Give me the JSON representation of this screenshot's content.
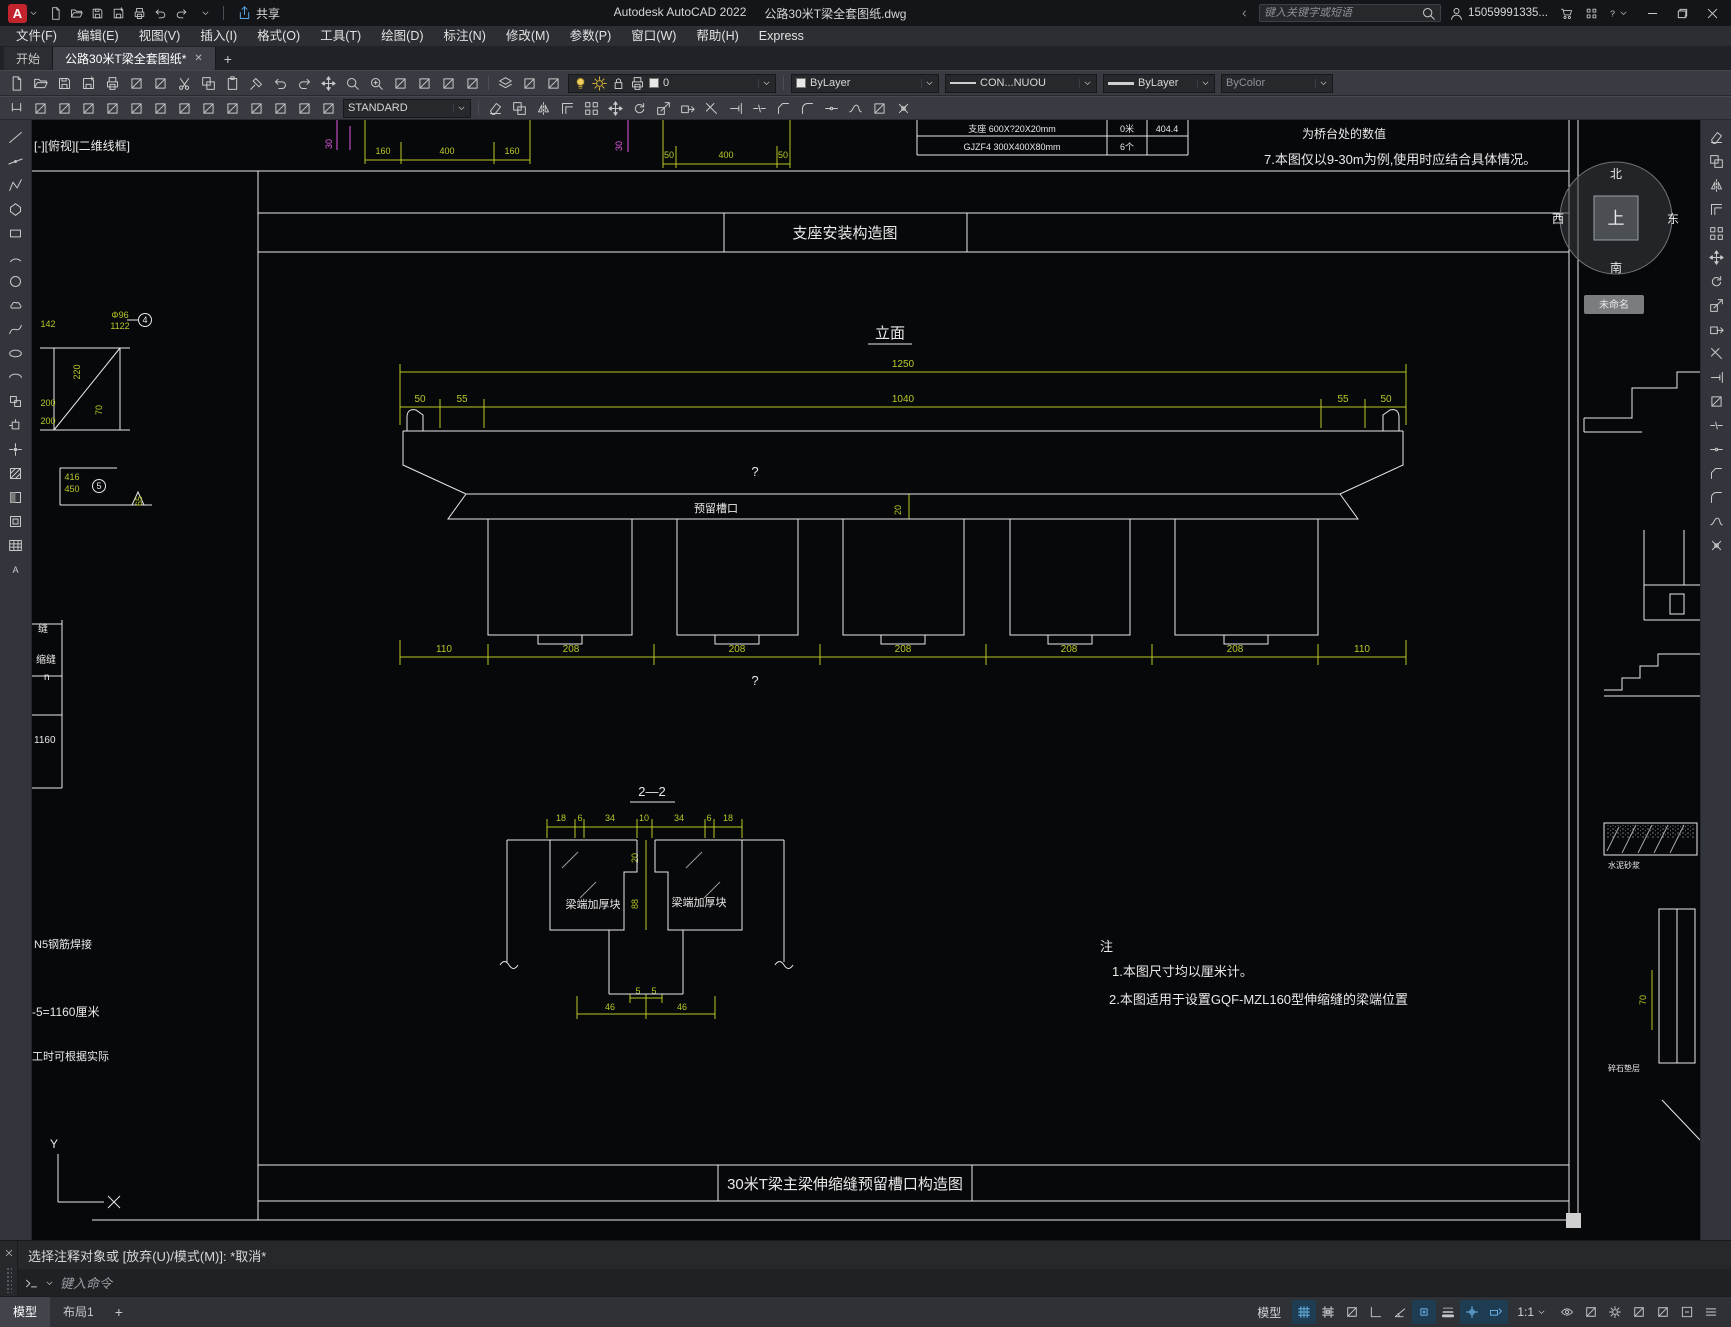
{
  "titlebar": {
    "logo": "A",
    "share": "共享",
    "app_title": "Autodesk AutoCAD 2022",
    "doc_title": "公路30米T梁全套图纸.dwg",
    "search_placeholder": "键入关键字或短语",
    "account": "15059991335...",
    "qat_icons": [
      "new",
      "open",
      "save",
      "save-as",
      "plot",
      "undo",
      "redo"
    ]
  },
  "menubar": {
    "items": [
      "文件(F)",
      "编辑(E)",
      "视图(V)",
      "插入(I)",
      "格式(O)",
      "工具(T)",
      "绘图(D)",
      "标注(N)",
      "修改(M)",
      "参数(P)",
      "窗口(W)",
      "帮助(H)",
      "Express"
    ]
  },
  "filetabs": {
    "start_tab": "开始",
    "doc_tab": "公路30米T梁全套图纸*",
    "close": "✕",
    "new_tab": "+"
  },
  "toolbar1": {
    "icons": [
      "new",
      "open",
      "save",
      "save-as",
      "plot",
      "plot-preview",
      "publish",
      "cut",
      "copy",
      "paste",
      "match-properties",
      "undo",
      "redo",
      "pan",
      "zoom",
      "zoom-window",
      "zoom-previous",
      "properties",
      "design-center",
      "tool-palettes"
    ],
    "layer_icons": [
      "layer-properties",
      "layer-states",
      "layer-isolate"
    ],
    "layer_value": "0",
    "color_value": "ByLayer",
    "linetype_value": "CON...NUOU",
    "lineweight_value": "ByLayer",
    "plotstyle_value": "ByColor"
  },
  "toolbar2": {
    "icons_left": [
      "dim-linear",
      "dim-aligned",
      "dim-arc-length",
      "dim-ordinate",
      "dim-radius",
      "dim-diameter",
      "dim-angular",
      "quick-dimension",
      "dim-baseline",
      "dim-continue",
      "dim-space",
      "dim-break",
      "tolerance",
      "center-mark"
    ],
    "style_value": "STANDARD",
    "icons_right": [
      "erase",
      "copy",
      "mirror",
      "offset",
      "array",
      "move",
      "rotate",
      "scale",
      "stretch",
      "trim",
      "extend",
      "break",
      "chamfer",
      "fillet",
      "join",
      "blend",
      "align",
      "explode"
    ]
  },
  "draw_toolbar": [
    "line",
    "construction-line",
    "polyline",
    "polygon",
    "rectangle",
    "arc",
    "circle",
    "revision-cloud",
    "spline",
    "ellipse",
    "ellipse-arc",
    "insert-block",
    "create-block",
    "point",
    "hatch",
    "gradient",
    "region",
    "table",
    "multiline-text"
  ],
  "modify_toolbar": [
    "erase",
    "copy",
    "mirror",
    "offset",
    "array",
    "move",
    "rotate",
    "scale",
    "stretch",
    "trim",
    "extend",
    "break-at-point",
    "break",
    "join",
    "chamfer",
    "fillet",
    "blend",
    "explode"
  ],
  "drawing": {
    "viewport_label": "[-][俯视][二维线框]",
    "sheet": {
      "top_title": "支座安装构造图",
      "bottom_title": "30米T梁主梁伸缩缝预留槽口构造图"
    },
    "elevation": {
      "title": "立面",
      "dim_total": "1250",
      "dims_top": [
        "50",
        "55",
        "1040",
        "55",
        "50"
      ],
      "slot_label": "预留槽口",
      "slot_dim": "20",
      "dims_bottom": [
        "110",
        "208",
        "208",
        "208",
        "208",
        "208",
        "110"
      ],
      "mark_a": "?",
      "mark_b": "?"
    },
    "section": {
      "title": "2—2",
      "dims_top": [
        "18",
        "6",
        "34",
        "10",
        "34",
        "6",
        "18"
      ],
      "dim_20": "20",
      "dim_88": "88",
      "thicken_left": "梁端加厚块",
      "thicken_right": "梁端加厚块",
      "dim_5a": "5",
      "dim_5b": "5",
      "dim_46a": "46",
      "dim_46b": "46"
    },
    "notes": {
      "title": "注",
      "line1": "1.本图尺寸均以厘米计。",
      "line2": "2.本图适用于设置GQF-MZL160型伸缩缝的梁端位置"
    },
    "corner_notes": {
      "line1": "为桥台处的数值",
      "line2": "7.本图仅以9-30m为例,使用时应结合具体情况。"
    },
    "top_table": {
      "r1c1": "支座 600X?20X20mm",
      "r1c2": "0米",
      "r1c3": "404.4",
      "r2c1": "GJZF4 300X400X80mm",
      "r2c2": "6个"
    },
    "top_dims_a": [
      "160",
      "400",
      "160"
    ],
    "top_dims_b": [
      "50",
      "400",
      "50"
    ],
    "mag_a": "30",
    "mag_b": "30",
    "left_detail": {
      "d142": "142",
      "phi": "Φ96",
      "n1122": "1122",
      "b4": "4",
      "d220": "220",
      "d200a": "200",
      "d70": "70",
      "d200b": "200",
      "d416": "416",
      "d450": "450",
      "b5": "5",
      "d65": "65",
      "t_feng": "缝",
      "t_suofeng": "缩缝",
      "t_n": "n",
      "d1160": "1160",
      "n5": "N5钢筋焊接",
      "eq": "-5=1160厘米",
      "note": "工时可根据实际",
      "ucs_y": "Y"
    },
    "right_detail": {
      "compass_n": "北",
      "compass_s": "南",
      "compass_w": "西",
      "compass_e": "东",
      "compass_up": "上",
      "view_chip": "未命名",
      "mortar": "水泥砂浆",
      "gravel": "碎石垫层",
      "d70": "70"
    }
  },
  "command": {
    "history": "选择注释对象或  [放弃(U)/模式(M)]:  *取消*",
    "placeholder": "键入命令"
  },
  "statusbar": {
    "model_tab": "模型",
    "layout_tab": "布局1",
    "new_layout": "+",
    "model_label": "模型",
    "scale_label": "1:1",
    "icons": [
      "grid",
      "snap",
      "infer-constraints",
      "ortho",
      "polar",
      "osnap",
      "lineweight",
      "selection-cycling",
      "dynamic-input"
    ],
    "icons2": [
      "annotation-visibility",
      "autoscale",
      "workspace",
      "annotation-monitor",
      "quick-properties",
      "clean-screen",
      "customize"
    ],
    "active": [
      "grid",
      "osnap",
      "dynamic-input",
      "selection-cycling"
    ]
  }
}
